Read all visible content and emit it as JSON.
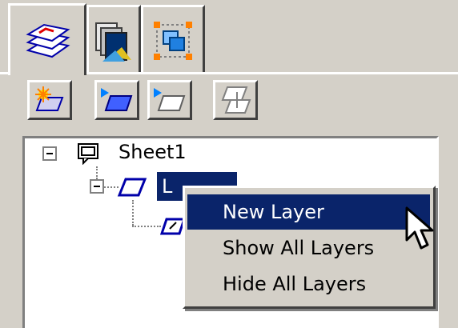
{
  "tabs": [
    {
      "icon": "layers-icon",
      "active": true
    },
    {
      "icon": "sheets-icon",
      "active": false
    },
    {
      "icon": "selection-icon",
      "active": false
    }
  ],
  "toolbar": [
    {
      "icon": "new-layer-icon"
    },
    {
      "icon": "show-layer-icon"
    },
    {
      "icon": "hide-layer-icon"
    },
    {
      "icon": "move-layer-icon"
    }
  ],
  "tree": {
    "sheet_label": "Sheet1",
    "layer_label": "L"
  },
  "context_menu": {
    "items": [
      {
        "label": "New Layer",
        "highlighted": true
      },
      {
        "label": "Show All Layers",
        "highlighted": false
      },
      {
        "label": "Hide All Layers",
        "highlighted": false
      }
    ]
  },
  "colors": {
    "face": "#d4d0c8",
    "highlight": "#0a246a"
  }
}
